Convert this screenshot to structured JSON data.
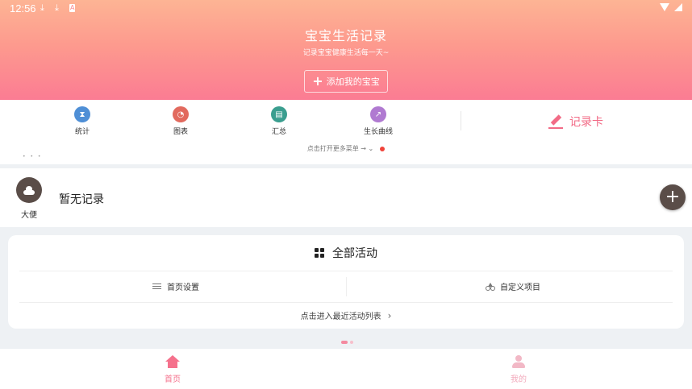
{
  "status_bar": {
    "time": "12:56",
    "icons": [
      "download-icon",
      "download-icon",
      "a-icon",
      "wifi-icon",
      "battery-icon"
    ]
  },
  "header": {
    "title": "宝宝生活记录",
    "subtitle": "记录宝宝健康生活每一天~",
    "add_baby_label": "添加我的宝宝"
  },
  "quick_menu": {
    "items": [
      {
        "label": "统计",
        "icon": "hourglass-icon",
        "color": "#4f8fd6"
      },
      {
        "label": "图表",
        "icon": "pie-chart-icon",
        "color": "#e26a5e"
      },
      {
        "label": "汇总",
        "icon": "document-icon",
        "color": "#3a9e8f"
      },
      {
        "label": "生长曲线",
        "icon": "trend-line-icon",
        "color": "#b07ad1"
      }
    ],
    "record_card_label": "记录卡",
    "more_hint": "点击打开更多菜单 → ⌄"
  },
  "record_row": {
    "category_label": "大便",
    "empty_text": "暂无记录",
    "add_icon": "plus-icon"
  },
  "activities": {
    "title": "全部活动",
    "home_settings_label": "首页设置",
    "custom_items_label": "自定义项目",
    "recent_list_label": "点击进入最近活动列表"
  },
  "bottom_nav": {
    "items": [
      {
        "label": "首页",
        "active": true,
        "color": "#f5718c"
      },
      {
        "label": "我的",
        "active": false,
        "color": "#f2a9bb"
      }
    ]
  },
  "colors": {
    "accent": "#f26b86",
    "header_gradient_top": "#fdb494",
    "header_gradient_bottom": "#fb7c93",
    "dark_button": "#5a4d48"
  }
}
